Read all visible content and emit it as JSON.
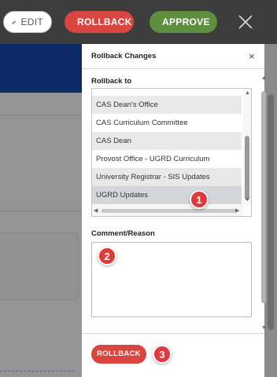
{
  "toolbar": {
    "edit_label": "EDIT",
    "rollback_label": "ROLLBACK",
    "approve_label": "APPROVE",
    "edit_icon": "pencil-icon",
    "rollback_icon": "undo-icon",
    "approve_icon": "user-check-icon",
    "close_icon": "close-icon"
  },
  "modal": {
    "title": "Rollback Changes",
    "close_glyph": "×",
    "rollback_to_label": "Rollback to",
    "options": [
      "CAS Dean's Office",
      "CAS Curriculum Committee",
      "CAS Dean",
      "Provost Office - UGRD Curriculum",
      "University Registrar - SIS Updates",
      "UGRD Updates"
    ],
    "selected_option": "UGRD Updates",
    "comment_label": "Comment/Reason",
    "comment_value": "",
    "submit_label": "ROLLBACK"
  },
  "badges": [
    "1",
    "2",
    "3"
  ],
  "colors": {
    "rollback_red": "#d9453f",
    "approve_green": "#5e8f3f",
    "badge_red": "#e2393d",
    "banner_navy": "#0b2a66"
  }
}
